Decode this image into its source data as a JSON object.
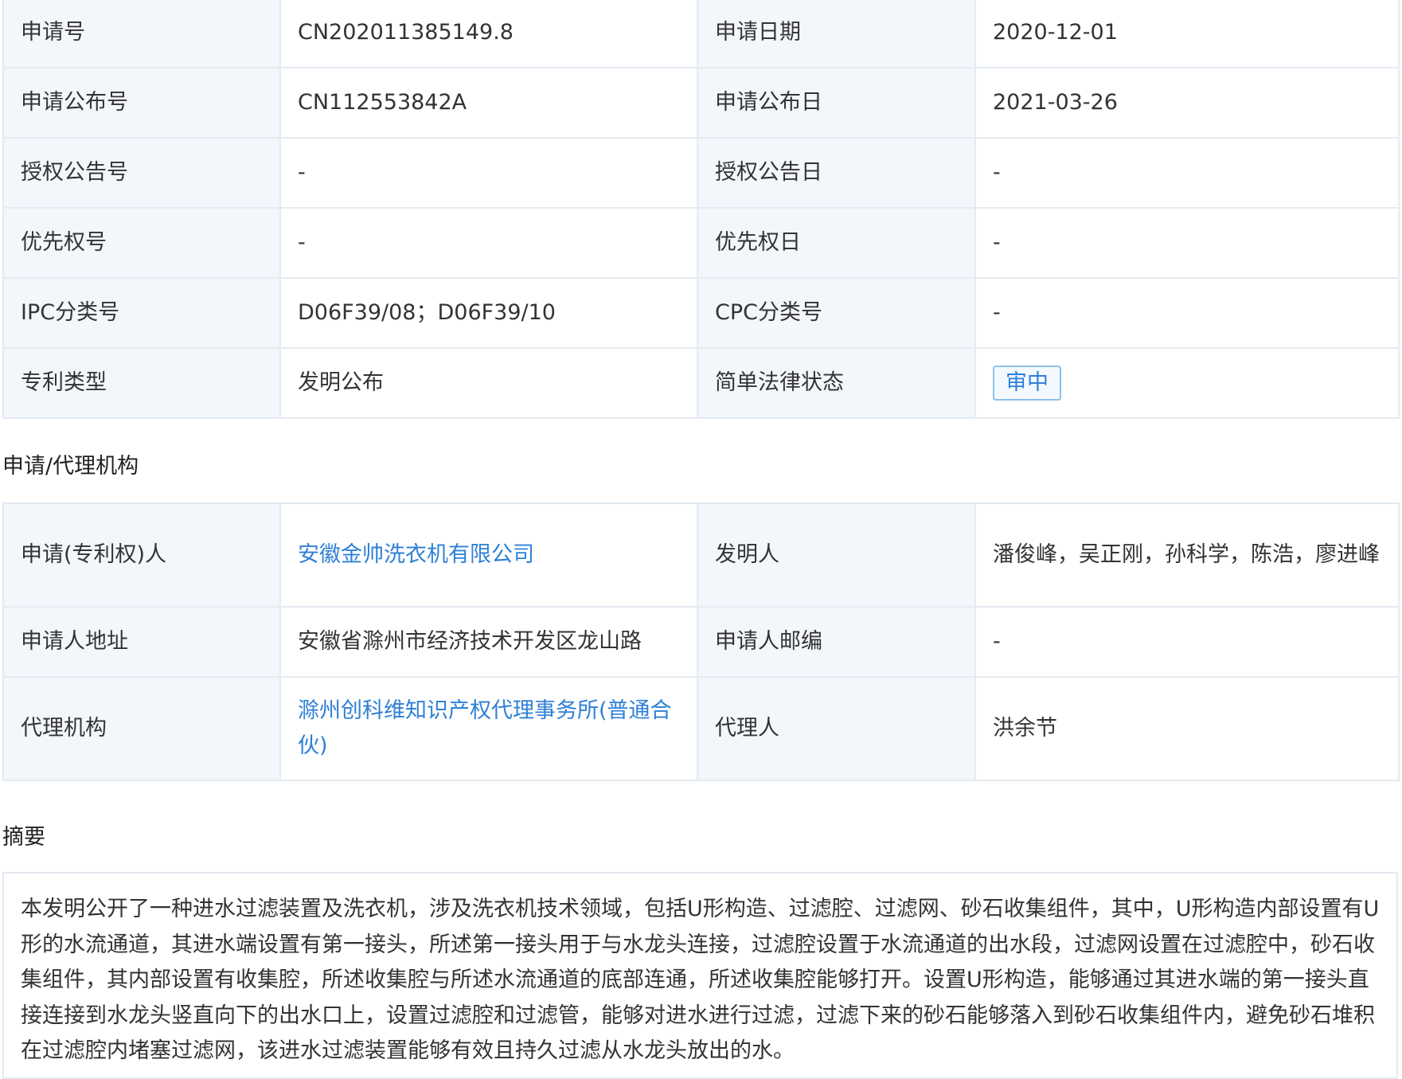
{
  "basic_info": [
    {
      "label1": "申请号",
      "value1": "CN202011385149.8",
      "label2": "申请日期",
      "value2": "2020-12-01"
    },
    {
      "label1": "申请公布号",
      "value1": "CN112553842A",
      "label2": "申请公布日",
      "value2": "2021-03-26"
    },
    {
      "label1": "授权公告号",
      "value1": "-",
      "label2": "授权公告日",
      "value2": "-"
    },
    {
      "label1": "优先权号",
      "value1": "-",
      "label2": "优先权日",
      "value2": "-"
    },
    {
      "label1": "IPC分类号",
      "value1": "D06F39/08；D06F39/10",
      "label2": "CPC分类号",
      "value2": "-"
    },
    {
      "label1": "专利类型",
      "value1": "发明公布",
      "label2": "简单法律状态",
      "value2": "审中"
    }
  ],
  "applicant_section": {
    "title": "申请/代理机构",
    "applicant_label": "申请(专利权)人",
    "applicant_value": "安徽金帅洗衣机有限公司",
    "inventor_label": "发明人",
    "inventor_value": "潘俊峰，吴正刚，孙科学，陈浩，廖进峰",
    "address_label": "申请人地址",
    "address_value": "安徽省滁州市经济技术开发区龙山路",
    "postcode_label": "申请人邮编",
    "postcode_value": "-",
    "agency_label": "代理机构",
    "agency_value": "滁州创科维知识产权代理事务所(普通合伙)",
    "agent_label": "代理人",
    "agent_value": "洪余节"
  },
  "abstract_section": {
    "title": "摘要",
    "text": "本发明公开了一种进水过滤装置及洗衣机，涉及洗衣机技术领域，包括U形构造、过滤腔、过滤网、砂石收集组件，其中，U形构造内部设置有U形的水流通道，其进水端设置有第一接头，所述第一接头用于与水龙头连接，过滤腔设置于水流通道的出水段，过滤网设置在过滤腔中，砂石收集组件，其内部设置有收集腔，所述收集腔与所述水流通道的底部连通，所述收集腔能够打开。设置U形构造，能够通过其进水端的第一接头直接连接到水龙头竖直向下的出水口上，设置过滤腔和过滤管，能够对进水进行过滤，过滤下来的砂石能够落入到砂石收集组件内，避免砂石堆积在过滤腔内堵塞过滤网，该进水过滤装置能够有效且持久过滤从水龙头放出的水。"
  },
  "colors": {
    "label_bg": "#f3f6fa",
    "border": "#e4ebf2",
    "link": "#2f80d6"
  }
}
